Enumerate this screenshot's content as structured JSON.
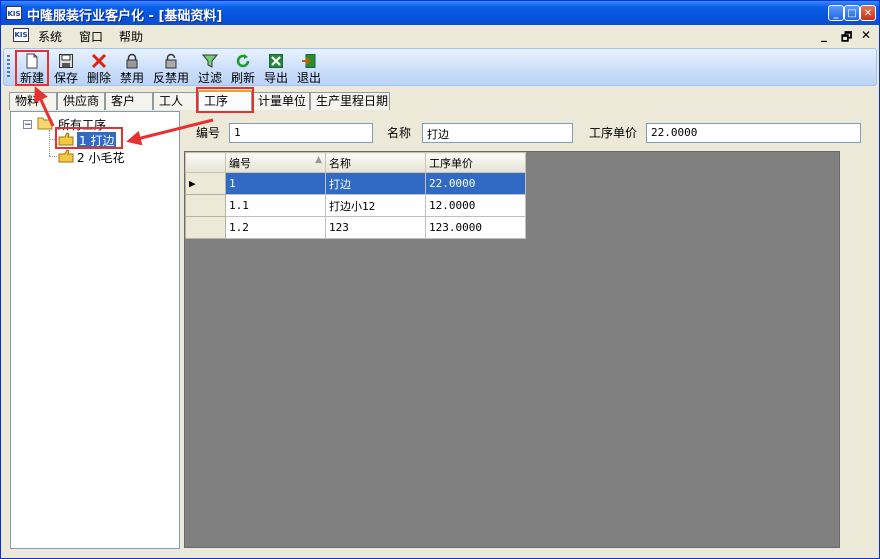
{
  "window": {
    "title": "中隆服装行业客户化 - [基础资料]",
    "app_icon_text": "KIS"
  },
  "menubar": {
    "items": [
      "系统",
      "窗口",
      "帮助"
    ],
    "mdi_controls": [
      "_",
      "🗗",
      "✕"
    ]
  },
  "toolbar": {
    "items": [
      {
        "label": "新建",
        "icon": "new-doc-icon"
      },
      {
        "label": "保存",
        "icon": "save-disk-icon"
      },
      {
        "label": "删除",
        "icon": "delete-x-icon"
      },
      {
        "label": "禁用",
        "icon": "lock-icon"
      },
      {
        "label": "反禁用",
        "icon": "unlock-icon"
      },
      {
        "label": "过滤",
        "icon": "filter-icon"
      },
      {
        "label": "刷新",
        "icon": "refresh-icon"
      },
      {
        "label": "导出",
        "icon": "excel-export-icon"
      },
      {
        "label": "退出",
        "icon": "exit-door-icon"
      }
    ]
  },
  "tabs": [
    "物料",
    "供应商",
    "客户",
    "工人",
    "工序",
    "计量单位",
    "生产里程日期"
  ],
  "active_tab": "工序",
  "tree": {
    "root": "所有工序",
    "children": [
      "1 打边",
      "2 小毛花"
    ],
    "selected": "1 打边"
  },
  "form": {
    "code_label": "编号",
    "code_value": "1",
    "name_label": "名称",
    "name_value": "打边",
    "price_label": "工序单价",
    "price_value": "22.0000"
  },
  "grid": {
    "columns": [
      "编号",
      "名称",
      "工序单价"
    ],
    "rows": [
      {
        "code": "1",
        "name": "打边",
        "price": "22.0000"
      },
      {
        "code": "1.1",
        "name": "打边小12",
        "price": "12.0000"
      },
      {
        "code": "1.2",
        "name": "123",
        "price": "123.0000"
      }
    ],
    "row_indicator": "▶"
  },
  "colors": {
    "title_bar": "#0a5fe8",
    "selection": "#316ac5",
    "annotation": "#e83030"
  }
}
